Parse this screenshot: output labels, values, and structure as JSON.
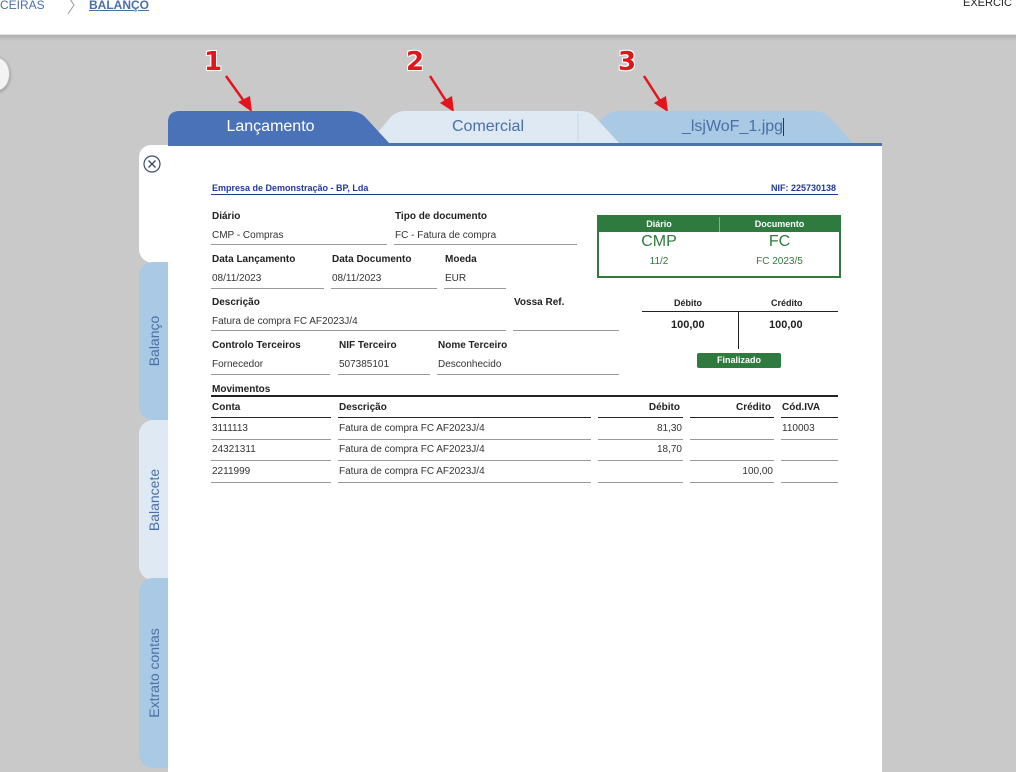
{
  "topbar": {
    "breadcrumb_prev": "CEIRAS",
    "breadcrumb_current": "BALANÇO",
    "right_text": "EXERCÍC"
  },
  "annotations": {
    "n1": "1",
    "n2": "2",
    "n3": "3"
  },
  "tabs": {
    "tab1": "Lançamento",
    "tab2": "Comercial",
    "tab3": "_lsjWoF_1.jpg"
  },
  "side_tabs": {
    "s1": "Balanço",
    "s2": "Balancete",
    "s3": "Extrato contas"
  },
  "document": {
    "company": "Empresa de Demonstração - BP, Lda",
    "nif": "NIF: 225730138",
    "diario_label": "Diário",
    "diario_value": "CMP - Compras",
    "tipo_label": "Tipo de documento",
    "tipo_value": "FC - Fatura de compra",
    "data_lanc_label": "Data Lançamento",
    "data_lanc_value": "08/11/2023",
    "data_doc_label": "Data Documento",
    "data_doc_value": "08/11/2023",
    "moeda_label": "Moeda",
    "moeda_value": "EUR",
    "descricao_label": "Descrição",
    "descricao_value": "Fatura de compra FC AF2023J/4",
    "vossa_ref_label": "Vossa Ref.",
    "vossa_ref_value": "",
    "controlo_label": "Controlo Terceiros",
    "controlo_value": "Fornecedor",
    "nif_terc_label": "NIF Terceiro",
    "nif_terc_value": "507385101",
    "nome_terc_label": "Nome Terceiro",
    "nome_terc_value": "Desconhecido"
  },
  "green_box": {
    "h1": "Diário",
    "h2": "Documento",
    "big1": "CMP",
    "big2": "FC",
    "small1": "11/2",
    "small2": "FC 2023/5"
  },
  "summary": {
    "debito_label": "Débito",
    "credito_label": "Crédito",
    "debito_value": "100,00",
    "credito_value": "100,00",
    "status": "Finalizado"
  },
  "movements": {
    "title": "Movimentos",
    "headers": {
      "conta": "Conta",
      "descricao": "Descrição",
      "debito": "Débito",
      "credito": "Crédito",
      "iva": "Cód.IVA"
    },
    "rows": [
      {
        "conta": "3111113",
        "descricao": "Fatura de compra FC AF2023J/4",
        "debito": "81,30",
        "credito": "",
        "iva": "110003"
      },
      {
        "conta": "24321311",
        "descricao": "Fatura de compra FC AF2023J/4",
        "debito": "18,70",
        "credito": "",
        "iva": ""
      },
      {
        "conta": "2211999",
        "descricao": "Fatura de compra FC AF2023J/4",
        "debito": "",
        "credito": "100,00",
        "iva": ""
      }
    ]
  },
  "colors": {
    "brand": "#4a72b8",
    "green": "#2f7a3e",
    "tab_light": "#a9c9e5"
  }
}
